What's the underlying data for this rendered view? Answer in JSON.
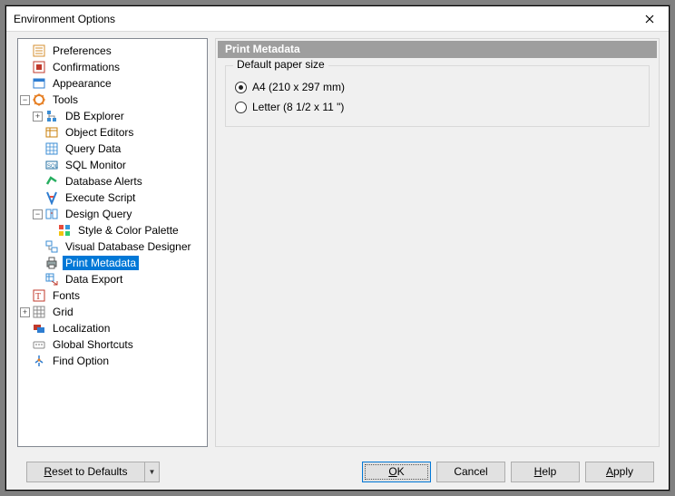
{
  "window": {
    "title": "Environment Options"
  },
  "tree": {
    "preferences": "Preferences",
    "confirmations": "Confirmations",
    "appearance": "Appearance",
    "tools": "Tools",
    "db_explorer": "DB Explorer",
    "object_editors": "Object Editors",
    "query_data": "Query Data",
    "sql_monitor": "SQL Monitor",
    "database_alerts": "Database Alerts",
    "execute_script": "Execute Script",
    "design_query": "Design Query",
    "style_color_palette": "Style & Color Palette",
    "visual_db_designer": "Visual Database Designer",
    "print_metadata": "Print Metadata",
    "data_export": "Data Export",
    "fonts": "Fonts",
    "grid": "Grid",
    "localization": "Localization",
    "global_shortcuts": "Global Shortcuts",
    "find_option": "Find Option"
  },
  "panel": {
    "title": "Print Metadata",
    "group_title": "Default paper size",
    "options": {
      "a4": "A4 (210 x 297 mm)",
      "letter": "Letter (8 1/2 x 11 \")",
      "selected": "a4"
    }
  },
  "buttons": {
    "reset": "Reset to Defaults",
    "ok": "OK",
    "cancel": "Cancel",
    "help": "Help",
    "apply": "Apply"
  }
}
